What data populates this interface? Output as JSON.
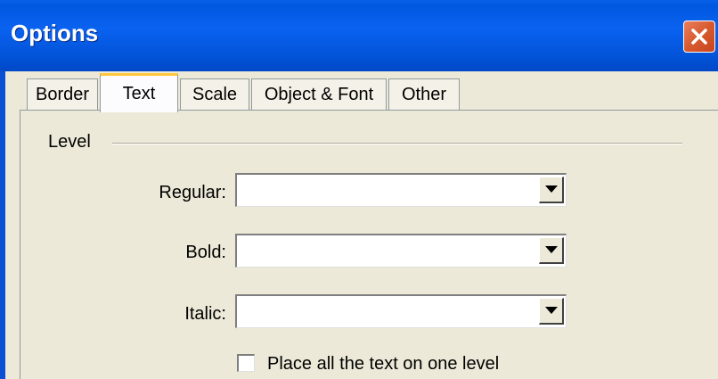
{
  "window": {
    "title": "Options",
    "close_icon": "close-icon"
  },
  "tabs": [
    {
      "label": "Border",
      "active": false
    },
    {
      "label": "Text",
      "active": true
    },
    {
      "label": "Scale",
      "active": false
    },
    {
      "label": "Object & Font",
      "active": false
    },
    {
      "label": "Other",
      "active": false
    }
  ],
  "level_group": {
    "label": "Level",
    "fields": [
      {
        "label": "Regular:",
        "value": ""
      },
      {
        "label": "Bold:",
        "value": ""
      },
      {
        "label": "Italic:",
        "value": ""
      }
    ],
    "checkbox": {
      "label": "Place all the text on one level",
      "checked": false
    }
  },
  "colors": {
    "titlebar": "#0a5fe8",
    "close_button": "#d75a2f",
    "active_tab_accent": "#ffc83c",
    "dialog_background": "#ece9d8"
  }
}
